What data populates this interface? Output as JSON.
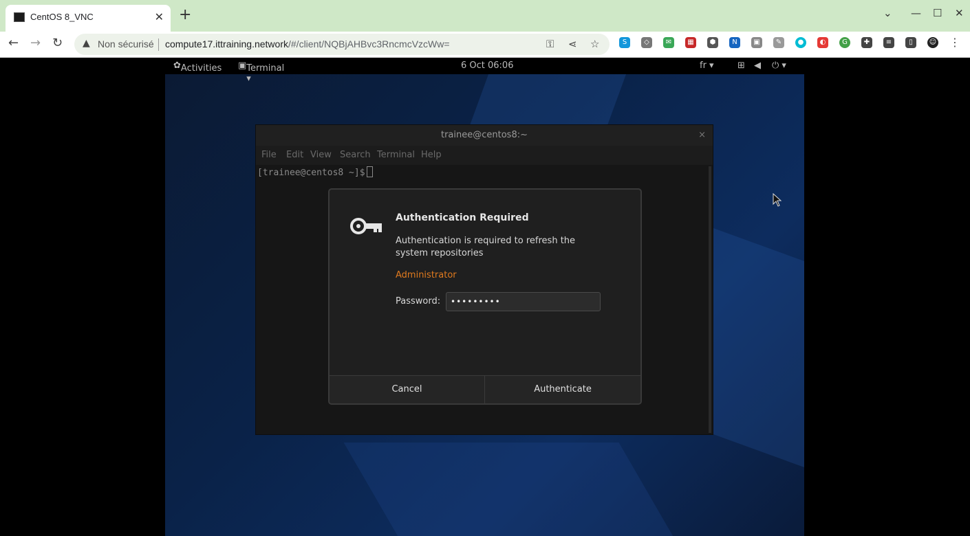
{
  "browser": {
    "tab_title": "CentOS 8_VNC",
    "tab_close": "✕",
    "new_tab": "+",
    "insecure_label": "Non sécurisé",
    "url_host": "compute17.ittraining.network",
    "url_path": "/#/client/NQBjAHBvc3RncmcVzcWw="
  },
  "remote": {
    "topbar": {
      "activities": "Activities",
      "app_menu": "Terminal ▾",
      "clock": "6 Oct  06:06",
      "keyboard_layout": "fr ▾"
    },
    "terminal": {
      "title": "trainee@centos8:~",
      "close": "×",
      "menu": [
        "File",
        "Edit",
        "View",
        "Search",
        "Terminal",
        "Help"
      ],
      "prompt": "[trainee@centos8 ~]$"
    }
  },
  "dialog": {
    "title": "Authentication Required",
    "message": "Authentication is required to refresh the system repositories",
    "user": "Administrator",
    "password_label": "Password:",
    "password_value": "•••••••••",
    "cancel_label": "Cancel",
    "authenticate_label": "Authenticate"
  },
  "colors": {
    "user_accent": "#e07a1f",
    "tabbar_bg": "#cfe8c7"
  }
}
